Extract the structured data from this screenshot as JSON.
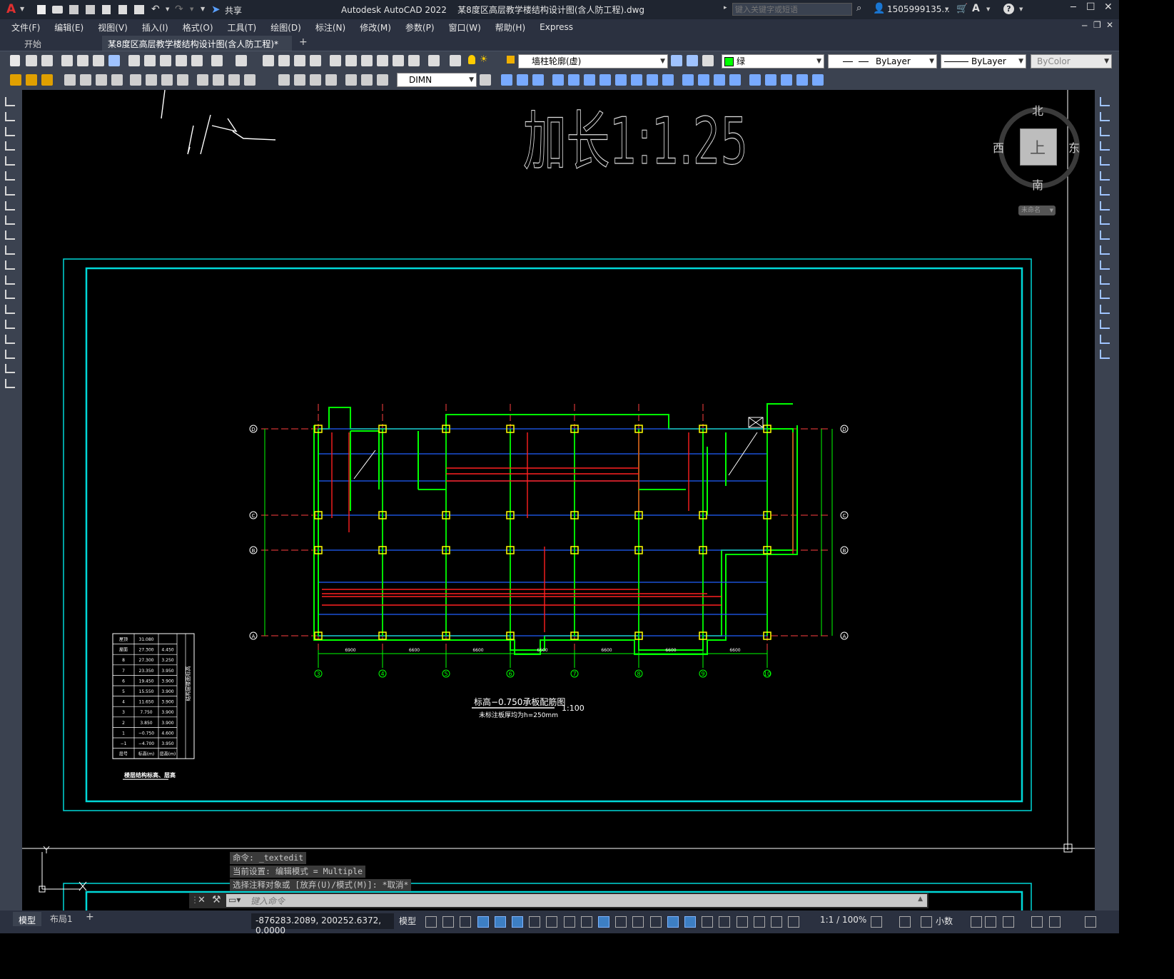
{
  "titlebar": {
    "app_logo": "A",
    "share_label": "共享",
    "title": "Autodesk AutoCAD 2022    某8度区高层教学楼结构设计图(含人防工程).dwg",
    "search_placeholder": "键入关键字或短语",
    "user": "1505999135...",
    "help": "?"
  },
  "menu": [
    "文件(F)",
    "编辑(E)",
    "视图(V)",
    "插入(I)",
    "格式(O)",
    "工具(T)",
    "绘图(D)",
    "标注(N)",
    "修改(M)",
    "参数(P)",
    "窗口(W)",
    "帮助(H)",
    "Express"
  ],
  "tabs": {
    "start": "开始",
    "doc": "某8度区高层教学楼结构设计图(含人防工程)*",
    "add": "+"
  },
  "toolbar": {
    "layer_value": "墙柱轮廓(虚)",
    "color_value": "绿",
    "linetype_value": "ByLayer",
    "lineweight_value": "ByLayer",
    "plotstyle_value": "ByColor",
    "dimstyle_value": "DIMN"
  },
  "viewcube": {
    "north": "北",
    "south": "南",
    "east": "东",
    "west": "西",
    "top": "上",
    "wcs": "未命名"
  },
  "drawing": {
    "big_text_left": "仅",
    "big_text_right": "加长1:1.25",
    "plan_title": "标高−0.750承板配筋图",
    "plan_scale": "1:100",
    "plan_subtitle": "未标注板厚均为h=250mm",
    "axes_bottom": [
      "3",
      "4",
      "5",
      "6",
      "7",
      "8",
      "9",
      "10"
    ],
    "axes_side": [
      "D",
      "C",
      "B",
      "A"
    ],
    "dims_bottom": [
      "6900",
      "6600",
      "6600",
      "6600",
      "6600",
      "6600",
      "6600"
    ],
    "table_caption": "楼层结构标高、层高",
    "table_rows": [
      [
        "屋顶",
        "31.080",
        ""
      ],
      [
        "屋面",
        "27.300",
        "4.450"
      ],
      [
        "8",
        "27.300",
        "3.250"
      ],
      [
        "7",
        "23.350",
        "3.950"
      ],
      [
        "6",
        "19.450",
        "3.900"
      ],
      [
        "5",
        "15.550",
        "3.900"
      ],
      [
        "4",
        "11.650",
        "3.900"
      ],
      [
        "3",
        "7.750",
        "3.900"
      ],
      [
        "2",
        "3.850",
        "3.900"
      ],
      [
        "1",
        "−0.750",
        "4.600"
      ],
      [
        "−1",
        "−4.700",
        "3.950"
      ],
      [
        "层号",
        "标高(m)",
        "层高(m)"
      ]
    ],
    "table_side_label": "结构层楼面标高"
  },
  "command": {
    "history": [
      "命令: _textedit",
      "当前设置: 编辑模式 = Multiple",
      "选择注释对象或 [放弃(U)/模式(M)]: *取消*"
    ],
    "placeholder": "键入命令"
  },
  "layout_tabs": [
    "模型",
    "布局1",
    "+"
  ],
  "status": {
    "coords": "-876283.2089, 200252.6372, 0.0000",
    "model": "模型",
    "scale": "1:1 / 100%",
    "units": "小数"
  },
  "colors": {
    "canvas": "#000000",
    "frame": "#00d8d8",
    "walls": "#00ff00",
    "rebar": "#ff2020",
    "axis": "#ff4040",
    "column": "#ffff00",
    "beam": "#2060ff"
  }
}
